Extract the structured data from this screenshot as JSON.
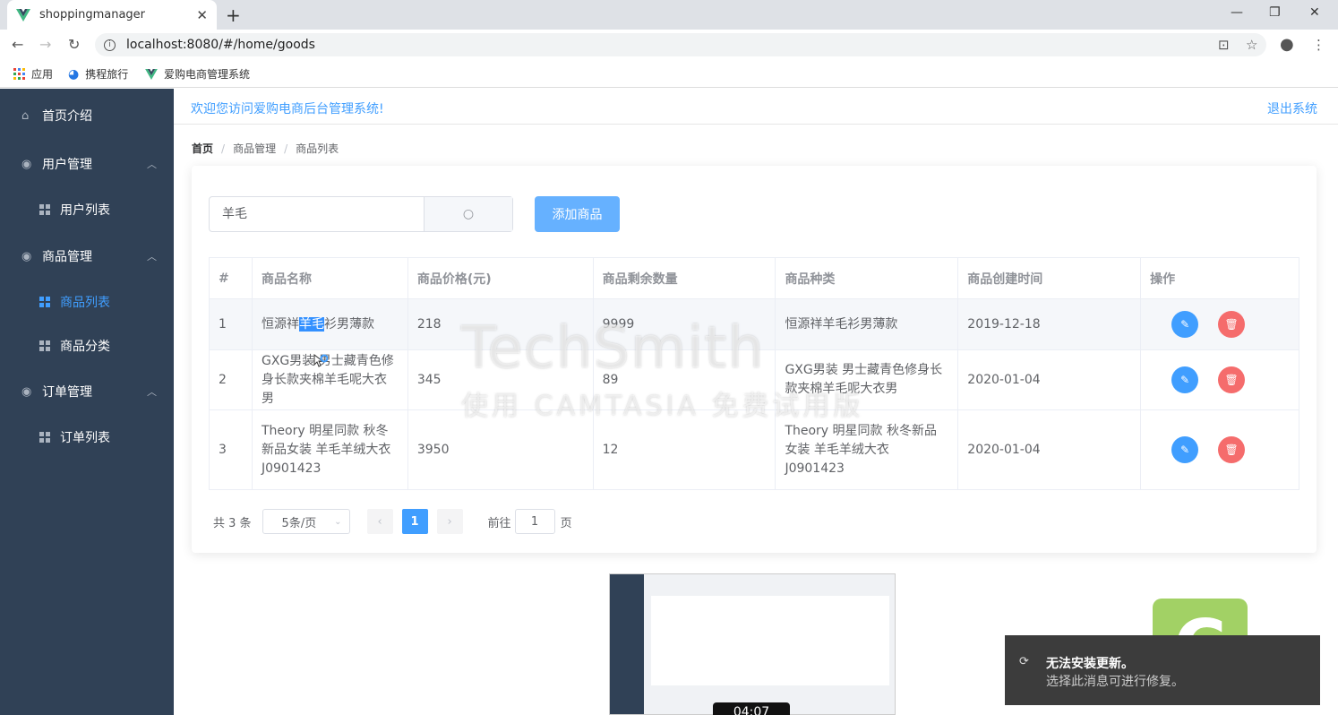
{
  "browser": {
    "tab_title": "shoppingmanager",
    "url": "localhost:8080/#/home/goods",
    "bookmarks": [
      "应用",
      "携程旅行",
      "爱购电商管理系统"
    ]
  },
  "sidebar": {
    "items": [
      {
        "label": "首页介绍",
        "icon": "home-icon"
      },
      {
        "label": "用户管理",
        "icon": "location-icon"
      },
      {
        "label": "用户列表",
        "icon": "menu-grid-icon"
      },
      {
        "label": "商品管理",
        "icon": "location-icon"
      },
      {
        "label": "商品列表",
        "icon": "menu-grid-icon",
        "active": true
      },
      {
        "label": "商品分类",
        "icon": "menu-grid-icon"
      },
      {
        "label": "订单管理",
        "icon": "location-icon"
      },
      {
        "label": "订单列表",
        "icon": "menu-grid-icon"
      }
    ]
  },
  "header": {
    "welcome": "欢迎您访问爱购电商后台管理系统!",
    "logout": "退出系统"
  },
  "breadcrumb": [
    "首页",
    "商品管理",
    "商品列表"
  ],
  "search": {
    "value": "羊毛"
  },
  "add_button": "添加商品",
  "table": {
    "columns": [
      "#",
      "商品名称",
      "商品价格(元)",
      "商品剩余数量",
      "商品种类",
      "商品创建时间",
      "操作"
    ],
    "rows": [
      {
        "index": "1",
        "name_pre": "恒源祥",
        "name_hl": "羊毛",
        "name_post": "衫男薄款",
        "price": "218",
        "stock": "9999",
        "category": "恒源祥羊毛衫男薄款",
        "created": "2019-12-18"
      },
      {
        "index": "2",
        "name": "GXG男装 男士藏青色修身长款夹棉羊毛呢大衣男",
        "price": "345",
        "stock": "89",
        "category": "GXG男装 男士藏青色修身长款夹棉羊毛呢大衣男",
        "created": "2020-01-04"
      },
      {
        "index": "3",
        "name": "Theory 明星同款 秋冬新品女装 羊毛羊绒大衣 J0901423",
        "price": "3950",
        "stock": "12",
        "category": "Theory 明星同款 秋冬新品女装 羊毛羊绒大衣 J0901423",
        "created": "2020-01-04"
      }
    ]
  },
  "pagination": {
    "total": "共 3 条",
    "page_size": "5条/页",
    "current_page": "1",
    "goto_label": "前往",
    "goto_value": "1",
    "page_suffix": "页"
  },
  "watermark": {
    "line1": "TechSmith",
    "line2": "使用 CAMTASIA 免费试用版"
  },
  "thumbnail_time": "04:07",
  "toast": {
    "title": "无法安装更新。",
    "message": "选择此消息可进行修复。"
  },
  "colors": {
    "sidebar_bg": "#304156",
    "accent": "#409eff",
    "danger": "#f56c6c"
  }
}
